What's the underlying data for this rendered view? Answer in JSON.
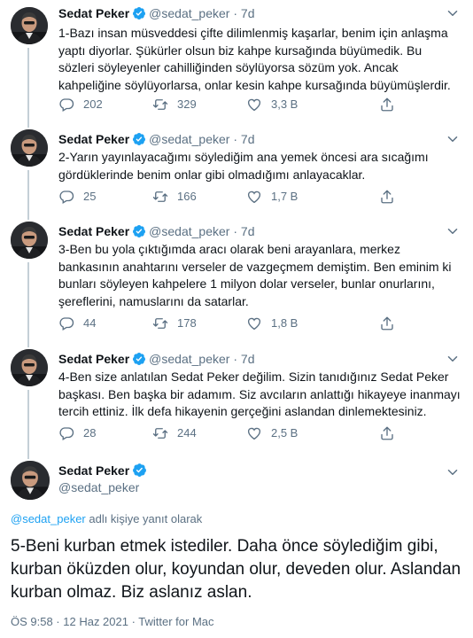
{
  "author": {
    "name": "Sedat Peker",
    "handle": "@sedat_peker",
    "time": "7d"
  },
  "tweets": [
    {
      "text": "1-Bazı insan müsveddesi çifte dilimlenmiş kaşarlar, benim için anlaşma yaptı diyorlar. Şükürler olsun biz kahpe kursağında büyümedik. Bu sözleri söyleyenler cahilliğinden söylüyorsa sözüm yok. Ancak kahpeliğine söylüyorlarsa, onlar kesin kahpe kursağında büyümüşlerdir.",
      "replies": "202",
      "retweets": "329",
      "likes": "3,3 B"
    },
    {
      "text": "2-Yarın yayınlayacağımı söylediğim ana yemek öncesi ara sıcağımı gördüklerinde benim onlar gibi olmadığımı anlayacaklar.",
      "replies": "25",
      "retweets": "166",
      "likes": "1,7 B"
    },
    {
      "text": "3-Ben bu yola çıktığımda aracı olarak beni arayanlara, merkez bankasının anahtarını verseler de vazgeçmem demiştim. Ben eminim ki bunları söyleyen kahpelere 1 milyon dolar verseler, bunlar onurlarını, şereflerini, namuslarını da satarlar.",
      "replies": "44",
      "retweets": "178",
      "likes": "1,8 B"
    },
    {
      "text": "4-Ben size anlatılan Sedat Peker değilim. Sizin tanıdığınız Sedat Peker başkası. Ben başka bir adamım. Siz avcıların anlattığı hikayeye inanmayı tercih ettiniz. İlk defa hikayenin gerçeğini aslandan dinlemektesiniz.",
      "replies": "28",
      "retweets": "244",
      "likes": "2,5 B"
    }
  ],
  "main_tweet": {
    "reply_handle": "@sedat_peker",
    "reply_suffix": " adlı kişiye yanıt olarak",
    "text": "5-Beni kurban etmek istediler. Daha önce söylediğim gibi, kurban öküzden olur, koyundan olur, deveden olur. Aslandan kurban olmaz. Biz aslanız aslan.",
    "meta": "ÖS 9:58 · 12 Haz 2021 · Twitter for Mac"
  },
  "icons": {
    "verified": "verified-badge-icon",
    "reply": "reply-icon",
    "retweet": "retweet-icon",
    "like": "heart-icon",
    "share": "share-icon",
    "caret": "chevron-down-icon"
  },
  "colors": {
    "accent": "#1da1f2",
    "muted": "#5b7083",
    "text": "#0f1419",
    "thread_line": "#c4cfd6"
  }
}
